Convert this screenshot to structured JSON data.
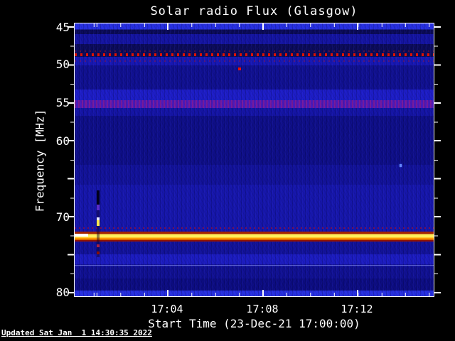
{
  "title": "Solar radio Flux (Glasgow)",
  "y_axis": {
    "label": "Frequency [MHz]",
    "ticks": [
      "45",
      "50",
      "55",
      "60",
      "70",
      "80"
    ]
  },
  "x_axis": {
    "label": "Start Time (23-Dec-21 17:00:00)",
    "ticks": [
      "17:04",
      "17:08",
      "17:12"
    ]
  },
  "footer": {
    "updated": "Updated Sat Jan  1 14:30:35 2022"
  },
  "colors": {
    "page_bg": "#000000",
    "frame": "#ffffff",
    "text": "#ffffff",
    "spectro_blue_dark": "#0c0c80",
    "spectro_blue_mid": "#1414a0",
    "spectro_blue_bright": "#2730e2",
    "band_purple": "#5c2cc8",
    "interference_red": "#dd1100",
    "emission_yellow": "#ffef5a",
    "emission_orange": "#ff9800",
    "emission_dark_red": "#911200",
    "artifact_white": "#ffffff"
  },
  "chart_data": {
    "type": "heatmap",
    "title": "Solar radio Flux (Glasgow)",
    "xlabel": "Start Time (23-Dec-21 17:00:00)",
    "ylabel": "Frequency [MHz]",
    "x_start": "17:00:00",
    "x_end": "17:15:30",
    "x_ticks": [
      "17:04",
      "17:08",
      "17:12"
    ],
    "x_minor_tick_interval_min": 1,
    "y_range_mhz": [
      45,
      80
    ],
    "y_ticks_mhz": [
      45,
      50,
      55,
      60,
      70,
      80
    ],
    "y_axis_inverted": true,
    "grid": false,
    "legend": "none",
    "background": "quiet blue solar radio noise with darker band near 60-67 MHz and brighter rows at the 45 and 80 MHz plot edges",
    "features": [
      {
        "kind": "continuous-emission-band",
        "frequency_mhz": 72.5,
        "time_span": "17:00-17:15:30",
        "intensity": "strong",
        "color": "yellow-orange with dark-red edges, white at start"
      },
      {
        "kind": "dotted-interference-line",
        "frequency_mhz": 50,
        "time_span": "17:00-17:15:30",
        "intensity": "moderate",
        "color": "red",
        "pattern": "periodic dots ~15s apart"
      },
      {
        "kind": "diffuse-band",
        "frequency_mhz": 56,
        "time_span": "17:00-17:15:30",
        "intensity": "weak",
        "color": "purple-magenta"
      },
      {
        "kind": "point-burst",
        "frequency_mhz": 51,
        "time": "17:07",
        "intensity": "weak",
        "color": "red"
      },
      {
        "kind": "instrument-artifact-column",
        "time": "17:01",
        "frequency_span_mhz": [
          66,
          75
        ],
        "color": "black gap with purple and white-yellow blobs and red dots"
      },
      {
        "kind": "faint-horizontal-line",
        "frequency_mhz": 76.5,
        "color": "pale blue-white"
      },
      {
        "kind": "point",
        "frequency_mhz": 63.5,
        "time": "17:13:40",
        "intensity": "very weak",
        "color": "light blue"
      }
    ]
  }
}
